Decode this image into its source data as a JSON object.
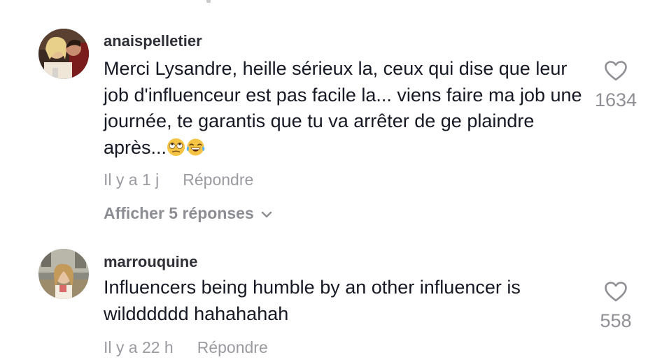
{
  "comments": [
    {
      "username": "anaispelletier",
      "text": "Merci Lysandre, heille sérieux la, ceux qui dise que leur job d'influenceur est pas facile la... viens faire ma job une journée, te garantis que tu va arrêter de ge plaindre après...",
      "emojis": [
        "eye-roll-emoji",
        "tears-of-joy-emoji"
      ],
      "time": "Il y a 1 j",
      "reply_label": "Répondre",
      "view_replies_label": "Afficher 5 réponses",
      "likes": "1634"
    },
    {
      "username": "marrouquine",
      "text": "Influencers being humble by an other influencer is wildddddd hahahahah",
      "time": "Il y a 22 h",
      "reply_label": "Répondre",
      "likes": "558"
    }
  ],
  "icons": {
    "like": "heart-outline-icon",
    "expand": "chevron-down-icon"
  },
  "colors": {
    "text_primary": "#161823",
    "text_secondary": "#9a9ba0",
    "icon": "#8f9096"
  }
}
